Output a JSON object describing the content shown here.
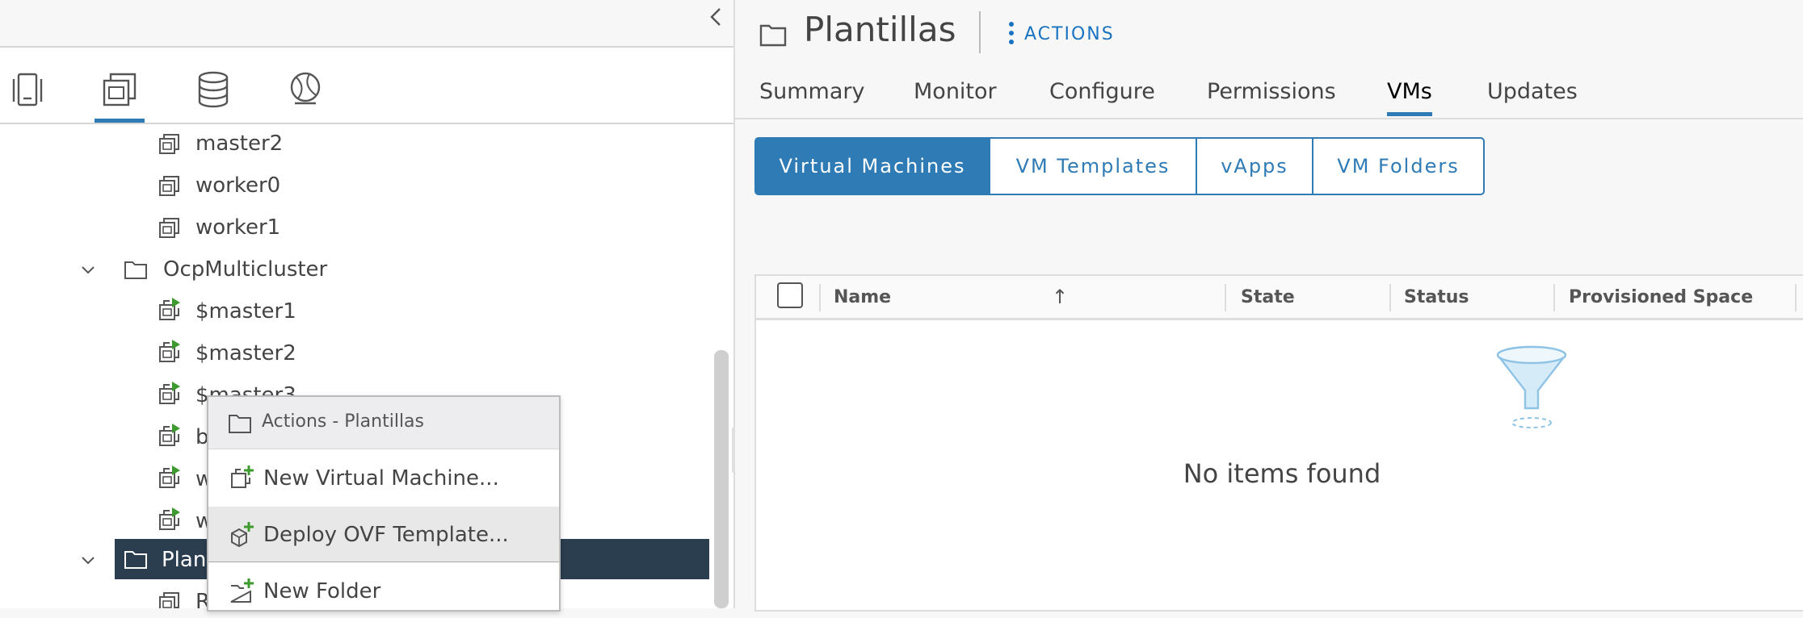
{
  "tree": {
    "rows": [
      {
        "label": "master2",
        "icon": "vm-template-icon"
      },
      {
        "label": "worker0",
        "icon": "vm-template-icon"
      },
      {
        "label": "worker1",
        "icon": "vm-template-icon"
      },
      {
        "label": "OcpMulticluster",
        "icon": "folder-icon"
      },
      {
        "label": "$master1",
        "icon": "vm-running-icon"
      },
      {
        "label": "$master2",
        "icon": "vm-running-icon"
      },
      {
        "label": "$master3",
        "icon": "vm-running-icon"
      },
      {
        "label": "b",
        "icon": "vm-running-icon"
      },
      {
        "label": "w",
        "icon": "vm-running-icon"
      },
      {
        "label": "w",
        "icon": "vm-running-icon"
      },
      {
        "label": "Plan",
        "icon": "folder-icon"
      },
      {
        "label": "R",
        "icon": "vm-template-icon"
      }
    ]
  },
  "context_menu": {
    "header": "Actions - Plantillas",
    "items": [
      {
        "label": "New Virtual Machine...",
        "icon": "new-vm-icon"
      },
      {
        "label": "Deploy OVF Template...",
        "icon": "deploy-ovf-icon"
      },
      {
        "label": "New Folder",
        "icon": "new-folder-icon"
      }
    ]
  },
  "header": {
    "title": "Plantillas",
    "actions_label": "ACTIONS"
  },
  "tabs": [
    "Summary",
    "Monitor",
    "Configure",
    "Permissions",
    "VMs",
    "Updates"
  ],
  "active_tab": "VMs",
  "segments": [
    "Virtual Machines",
    "VM Templates",
    "vApps",
    "VM Folders"
  ],
  "active_segment": "Virtual Machines",
  "grid": {
    "columns": [
      "Name",
      "State",
      "Status",
      "Provisioned Space"
    ],
    "sort_indicator": "↑",
    "empty_text": "No items found"
  },
  "colors": {
    "accent": "#2f7bb5",
    "selected_row": "#2b3e4f",
    "running_green": "#3d9a2e"
  }
}
